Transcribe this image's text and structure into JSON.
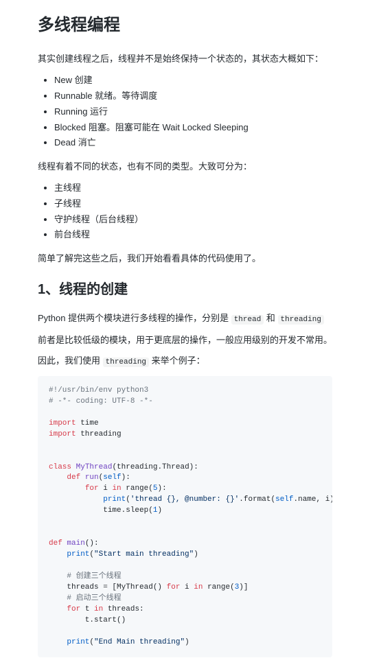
{
  "h1": "多线程编程",
  "p1": "其实创建线程之后，线程并不是始终保持一个状态的，其状态大概如下：",
  "states": [
    "New 创建",
    "Runnable 就绪。等待调度",
    "Running 运行",
    "Blocked 阻塞。阻塞可能在 Wait Locked Sleeping",
    "Dead 消亡"
  ],
  "p2": "线程有着不同的状态，也有不同的类型。大致可分为：",
  "types": [
    "主线程",
    "子线程",
    "守护线程（后台线程）",
    "前台线程"
  ],
  "p3": "简单了解完这些之后，我们开始看看具体的代码使用了。",
  "h2": "1、线程的创建",
  "p4_a": "Python 提供两个模块进行多线程的操作，分别是 ",
  "p4_code1": "thread",
  "p4_b": " 和 ",
  "p4_code2": "threading",
  "p5": "前者是比较低级的模块，用于更底层的操作，一般应用级别的开发不常用。",
  "p6_a": "因此，我们使用 ",
  "p6_code": "threading",
  "p6_b": " 来举个例子：",
  "code": {
    "l1": "#!/usr/bin/env python3",
    "l2": "# -*- coding: UTF-8 -*-",
    "imp": "import",
    "time": " time",
    "threading": " threading",
    "class": "class",
    "MyThread": "MyThread",
    "paren_open": "(",
    "extends": "threading.Thread):",
    "def": "def",
    "run": "run",
    "self": "self",
    "rparen_colon": "):",
    "for": "for",
    "i_in": " i ",
    "in": "in",
    "range": " range(",
    "five": "5",
    "rparen_colon2": "):",
    "print": "print",
    "fmt_str": "'thread {}, @number: {}'",
    "dot_format": ".format(",
    "dot_name_i": ".name, i))",
    "sleep": "            time.sleep(",
    "one": "1",
    "rparen": ")",
    "main": "main",
    "empty_args": "():",
    "start_str": "\"Start main threading\"",
    "print_close": ")",
    "cmt_create": "# 创建三个线程",
    "threads_eq": "    threads = [MyThread() ",
    "range3_open": " range(",
    "three": "3",
    "range3_close": ")]",
    "cmt_start": "# 启动三个线程",
    "t_in": " t ",
    "threads_colon": " threads:",
    "tstart": "        t.start()",
    "end_str": "\"End Main threading\""
  }
}
